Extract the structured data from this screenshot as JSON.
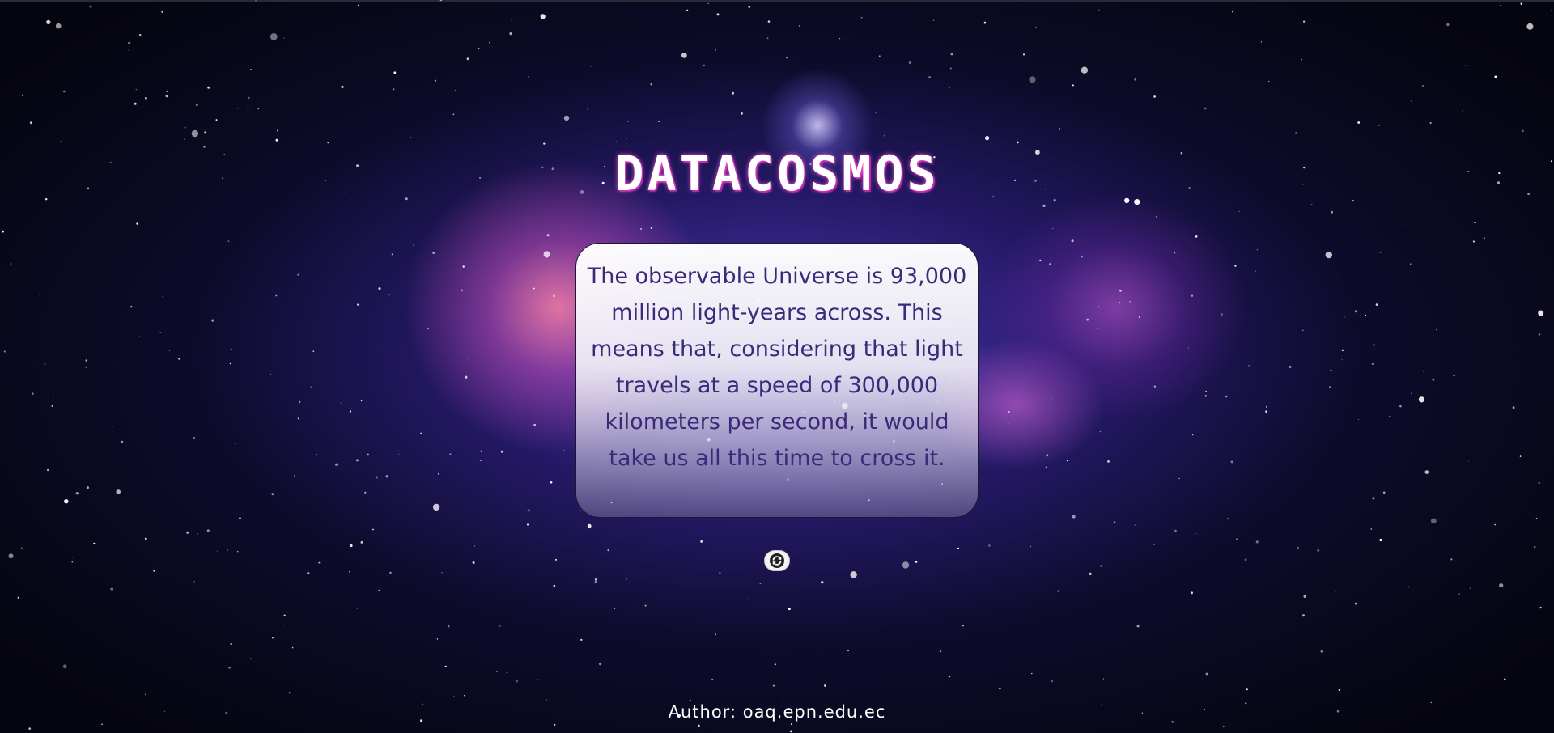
{
  "header": {
    "title": "DATACOSMOS"
  },
  "fact": {
    "text": "The observable Universe is 93,000 million light-years across. This means that, considering that light travels at a speed of 300,000 kilometers per second, it would take us all this time to cross it."
  },
  "controls": {
    "refresh_icon": "refresh-icon"
  },
  "footer": {
    "author_label": "Author:",
    "author_link": "oaq.epn.edu.ec"
  },
  "colors": {
    "title_glow": "#ff4fd8",
    "fact_text": "#3b2a7a",
    "background": "#0e0c2e"
  }
}
